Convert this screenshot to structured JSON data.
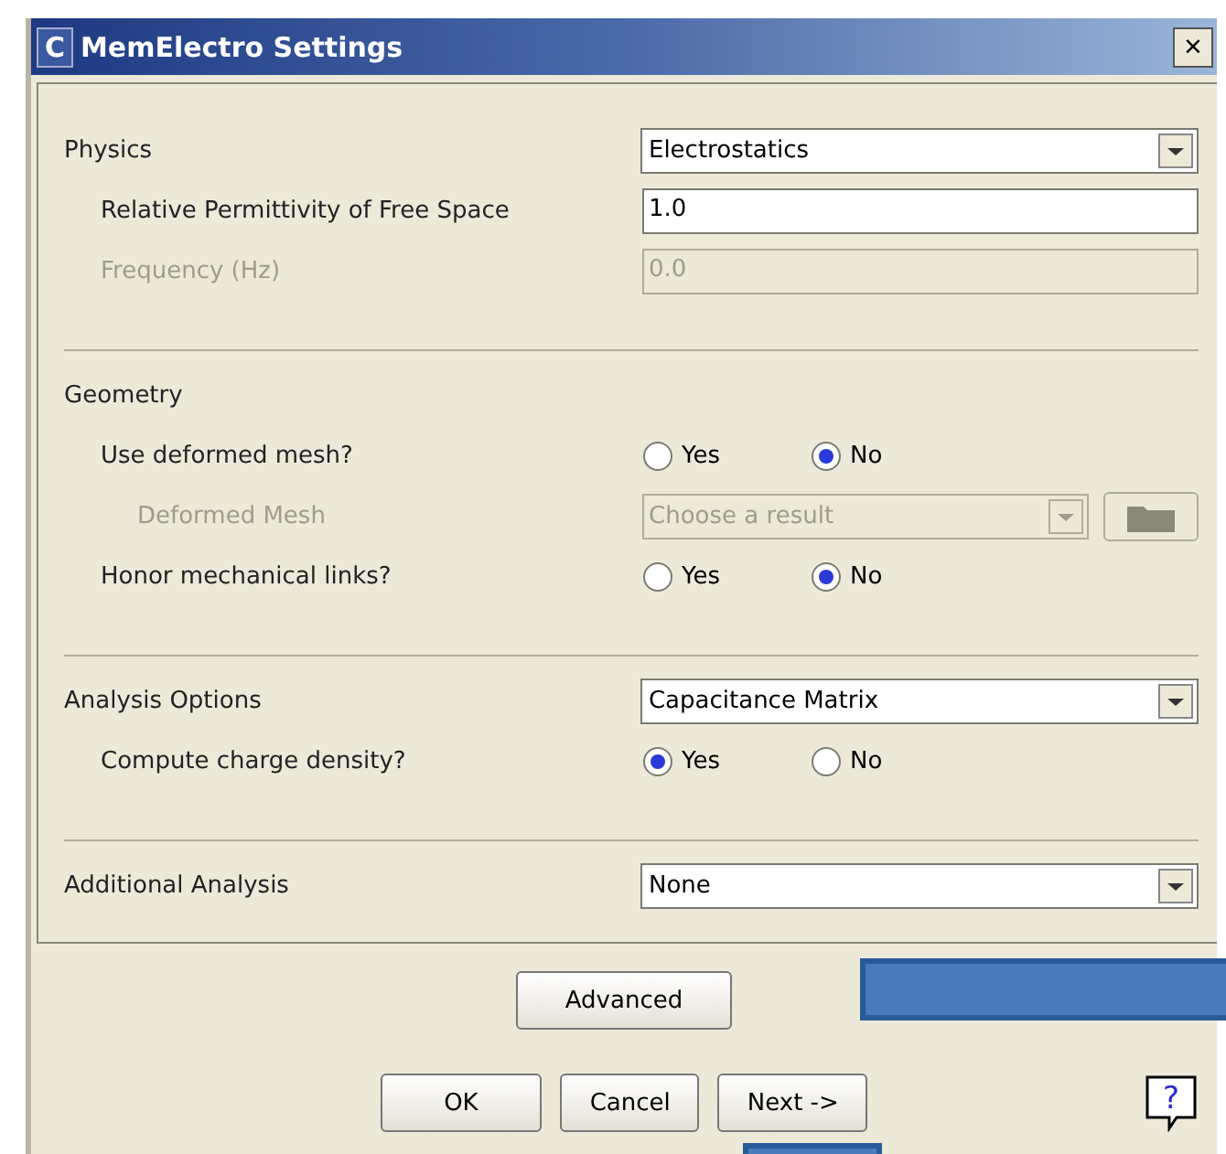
{
  "window": {
    "title": "MemElectro Settings",
    "close": "×",
    "app_icon": "C"
  },
  "sections": [
    {
      "kind": "dropdown",
      "label": "Physics",
      "value": "Electrostatics",
      "disabled": false,
      "children": [
        {
          "kind": "text",
          "label": "Relative Permittivity of Free Space",
          "value": "1.0",
          "disabled": false
        },
        {
          "kind": "text",
          "label": "Frequency (Hz)",
          "value": "0.0",
          "disabled": true
        }
      ]
    },
    {
      "kind": "heading",
      "label": "Geometry",
      "children": [
        {
          "kind": "radio",
          "label": "Use deformed mesh?",
          "options": [
            {
              "label": "Yes",
              "selected": false
            },
            {
              "label": "No",
              "selected": true
            }
          ],
          "children": [
            {
              "kind": "file_dropdown",
              "label": "Deformed Mesh",
              "value": "Choose a result",
              "disabled": true
            }
          ]
        },
        {
          "kind": "radio",
          "label": "Honor mechanical links?",
          "options": [
            {
              "label": "Yes",
              "selected": false
            },
            {
              "label": "No",
              "selected": true
            }
          ]
        }
      ]
    },
    {
      "kind": "dropdown",
      "label": "Analysis Options",
      "value": "Capacitance Matrix",
      "disabled": false,
      "children": [
        {
          "kind": "radio",
          "label": "Compute charge density?",
          "options": [
            {
              "label": "Yes",
              "selected": true
            },
            {
              "label": "No",
              "selected": false
            }
          ]
        }
      ]
    },
    {
      "kind": "dropdown",
      "label": "Additional Analysis",
      "value": "None",
      "disabled": false
    }
  ],
  "advanced_button": "Advanced",
  "buttons": [
    "OK",
    "Cancel",
    "Next ->"
  ],
  "help": "?"
}
